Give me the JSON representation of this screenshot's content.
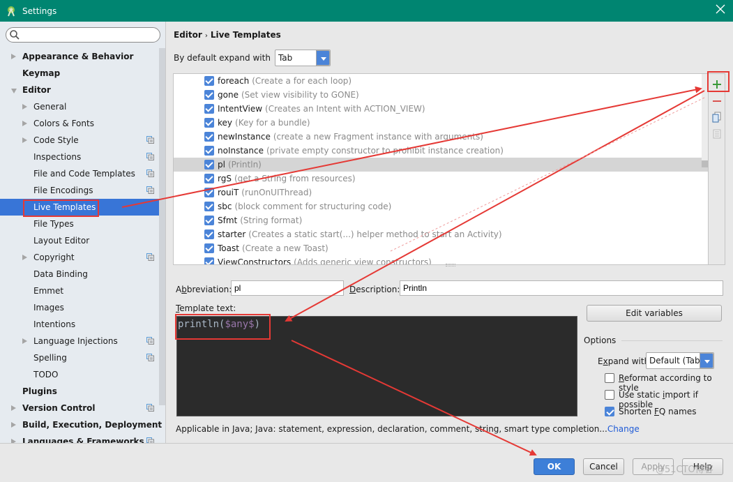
{
  "window": {
    "title": "Settings",
    "close_icon": "close-icon",
    "app_icon": "android-studio-icon"
  },
  "sidebar": {
    "search": {
      "value": "",
      "placeholder": ""
    },
    "items": [
      {
        "label": "Appearance & Behavior",
        "level": 0,
        "arrow": "right",
        "project": false,
        "selected": false
      },
      {
        "label": "Keymap",
        "level": 0,
        "arrow": "none",
        "project": false,
        "selected": false
      },
      {
        "label": "Editor",
        "level": 0,
        "arrow": "down",
        "project": false,
        "selected": false
      },
      {
        "label": "General",
        "level": 1,
        "arrow": "right",
        "project": false,
        "selected": false
      },
      {
        "label": "Colors & Fonts",
        "level": 1,
        "arrow": "right",
        "project": false,
        "selected": false
      },
      {
        "label": "Code Style",
        "level": 1,
        "arrow": "right",
        "project": true,
        "selected": false
      },
      {
        "label": "Inspections",
        "level": 1,
        "arrow": "none",
        "project": true,
        "selected": false
      },
      {
        "label": "File and Code Templates",
        "level": 1,
        "arrow": "none",
        "project": true,
        "selected": false
      },
      {
        "label": "File Encodings",
        "level": 1,
        "arrow": "none",
        "project": true,
        "selected": false
      },
      {
        "label": "Live Templates",
        "level": 1,
        "arrow": "none",
        "project": false,
        "selected": true
      },
      {
        "label": "File Types",
        "level": 1,
        "arrow": "none",
        "project": false,
        "selected": false
      },
      {
        "label": "Layout Editor",
        "level": 1,
        "arrow": "none",
        "project": false,
        "selected": false
      },
      {
        "label": "Copyright",
        "level": 1,
        "arrow": "right",
        "project": true,
        "selected": false
      },
      {
        "label": "Data Binding",
        "level": 1,
        "arrow": "none",
        "project": false,
        "selected": false
      },
      {
        "label": "Emmet",
        "level": 1,
        "arrow": "none",
        "project": false,
        "selected": false
      },
      {
        "label": "Images",
        "level": 1,
        "arrow": "none",
        "project": false,
        "selected": false
      },
      {
        "label": "Intentions",
        "level": 1,
        "arrow": "none",
        "project": false,
        "selected": false
      },
      {
        "label": "Language Injections",
        "level": 1,
        "arrow": "right",
        "project": true,
        "selected": false
      },
      {
        "label": "Spelling",
        "level": 1,
        "arrow": "none",
        "project": true,
        "selected": false
      },
      {
        "label": "TODO",
        "level": 1,
        "arrow": "none",
        "project": false,
        "selected": false
      },
      {
        "label": "Plugins",
        "level": 0,
        "arrow": "none",
        "project": false,
        "selected": false
      },
      {
        "label": "Version Control",
        "level": 0,
        "arrow": "right",
        "project": true,
        "selected": false
      },
      {
        "label": "Build, Execution, Deployment",
        "level": 0,
        "arrow": "right",
        "project": false,
        "selected": false
      },
      {
        "label": "Languages & Frameworks",
        "level": 0,
        "arrow": "right",
        "project": true,
        "selected": false
      }
    ]
  },
  "main": {
    "breadcrumb": {
      "parent": "Editor",
      "separator": "›",
      "current": "Live Templates"
    },
    "expand_default": {
      "label": "By default expand with",
      "value": "Tab"
    },
    "templates": [
      {
        "abbr": "foreach",
        "desc": "(Create a for each loop)",
        "checked": true,
        "selected": false
      },
      {
        "abbr": "gone",
        "desc": "(Set view visibility to GONE)",
        "checked": true,
        "selected": false
      },
      {
        "abbr": "IntentView",
        "desc": "(Creates an Intent with ACTION_VIEW)",
        "checked": true,
        "selected": false
      },
      {
        "abbr": "key",
        "desc": "(Key for a bundle)",
        "checked": true,
        "selected": false
      },
      {
        "abbr": "newInstance",
        "desc": "(create a new Fragment instance with arguments)",
        "checked": true,
        "selected": false
      },
      {
        "abbr": "noInstance",
        "desc": "(private empty constructor to prohibit instance creation)",
        "checked": true,
        "selected": false
      },
      {
        "abbr": "pl",
        "desc": "(Println)",
        "checked": true,
        "selected": true
      },
      {
        "abbr": "rgS",
        "desc": "(get a String from resources)",
        "checked": true,
        "selected": false
      },
      {
        "abbr": "rouiT",
        "desc": "(runOnUIThread)",
        "checked": true,
        "selected": false
      },
      {
        "abbr": "sbc",
        "desc": "(block comment for structuring code)",
        "checked": true,
        "selected": false
      },
      {
        "abbr": "Sfmt",
        "desc": "(String format)",
        "checked": true,
        "selected": false
      },
      {
        "abbr": "starter",
        "desc": "(Creates a static start(...) helper method to start an Activity)",
        "checked": true,
        "selected": false
      },
      {
        "abbr": "Toast",
        "desc": "(Create a new Toast)",
        "checked": true,
        "selected": false
      },
      {
        "abbr": "ViewConstructors",
        "desc": "(Adds generic view constructors)",
        "checked": true,
        "selected": false
      }
    ],
    "toolbar": {
      "add_icon": "plus-icon",
      "remove_icon": "minus-icon",
      "copy_icon": "copy-icon",
      "edit_icon": "document-icon"
    },
    "abbreviation": {
      "label_pre": "A",
      "label_mn": "b",
      "label_post": "breviation:",
      "value": "pl"
    },
    "description": {
      "label_mn": "D",
      "label_post": "escription:",
      "value": "Println"
    },
    "template_text": {
      "label_mn": "T",
      "label_post": "emplate text:",
      "code_prefix": "println(",
      "code_var": "$any$",
      "code_suffix": ")"
    },
    "edit_variables_label": "Edit variables",
    "options": {
      "title": "Options",
      "expand_with": {
        "label_pre": "E",
        "label_mn": "x",
        "label_post": "pand with",
        "value": "Default (Tab)"
      },
      "reformat": {
        "label_mn": "R",
        "label_post": "eformat according to style",
        "checked": false
      },
      "static_import": {
        "label_pre": "Use static ",
        "label_mn": "i",
        "label_post": "mport if possible",
        "checked": false
      },
      "shorten_fq": {
        "label_pre": "Shorten ",
        "label_mn": "F",
        "label_post": "Q names",
        "checked": true
      }
    },
    "applicable": {
      "text": "Applicable in Java; Java: statement, expression, declaration, comment, string, smart type completion...",
      "link": "Change"
    }
  },
  "footer": {
    "ok": "OK",
    "cancel": "Cancel",
    "apply": "Apply",
    "help": "Help"
  },
  "watermark": "@51CTO博客",
  "annotation_color": "#e53935"
}
